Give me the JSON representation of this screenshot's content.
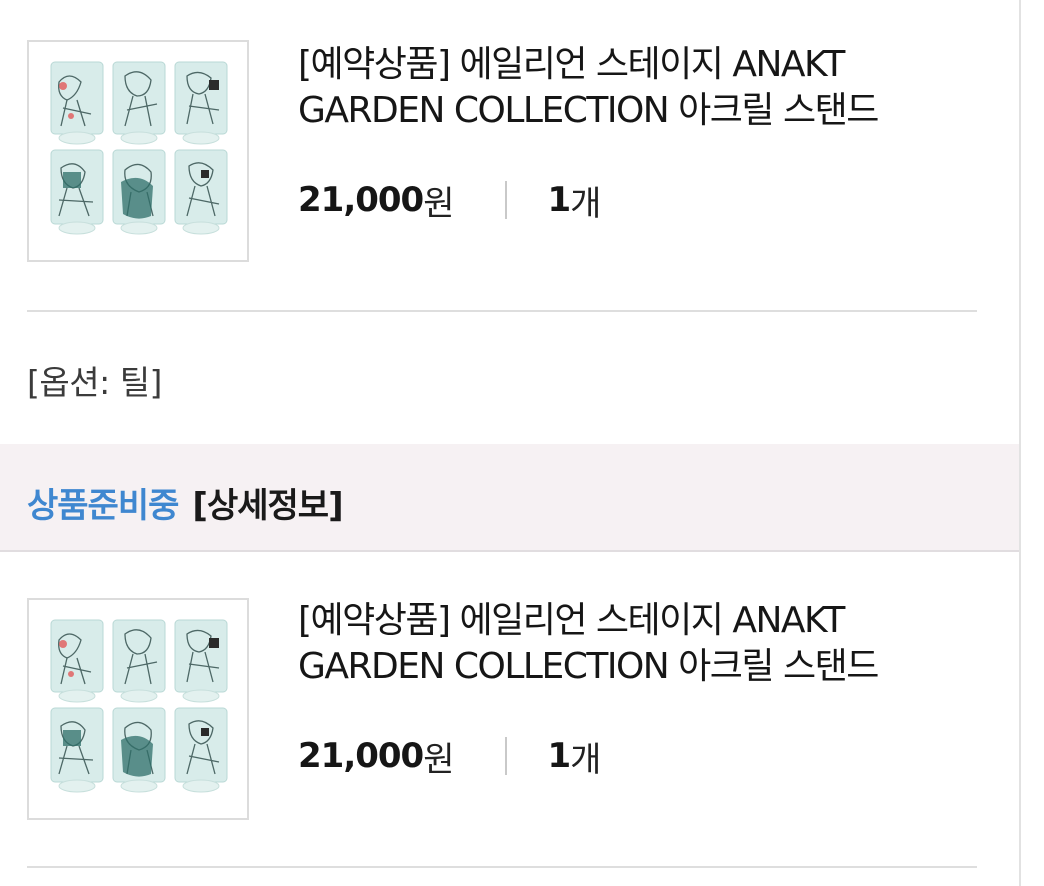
{
  "order_items": [
    {
      "title": "[예약상품] 에일리언 스테이지 ANAKT\nGARDEN COLLECTION 아크릴 스탠드",
      "price": "21,000",
      "price_unit": "원",
      "quantity": "1",
      "quantity_unit": "개",
      "thumbnail_icon": "acrylic-stand-product-image",
      "option": "[옵션: 틸]"
    },
    {
      "title": "[예약상품] 에일리언 스테이지 ANAKT\nGARDEN COLLECTION 아크릴 스탠드",
      "price": "21,000",
      "price_unit": "원",
      "quantity": "1",
      "quantity_unit": "개",
      "thumbnail_icon": "acrylic-stand-product-image"
    }
  ],
  "status": {
    "label": "상품준비중",
    "detail_link": "[상세정보]",
    "label_color": "#3f87d0"
  }
}
